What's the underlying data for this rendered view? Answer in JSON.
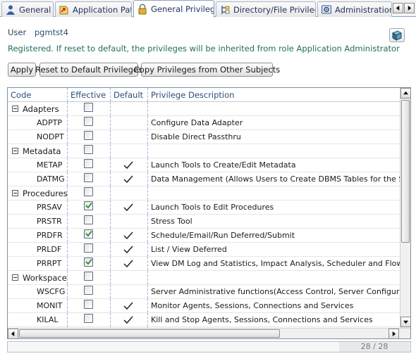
{
  "tabs": [
    {
      "label": "General",
      "icon": "user-icon",
      "active": false
    },
    {
      "label": "Application Path",
      "icon": "app-path-icon",
      "active": false
    },
    {
      "label": "General Privileges",
      "icon": "lock-icon",
      "active": true
    },
    {
      "label": "Directory/File Privileges",
      "icon": "directory-icon",
      "active": false
    },
    {
      "label": "Administration Fi",
      "icon": "admin-icon",
      "active": false
    }
  ],
  "user": {
    "label": "User",
    "value": "pgmtst4"
  },
  "registered_text": "Registered. If reset to default, the privileges will be inherited from role Application Administrator",
  "buttons": {
    "apply": "Apply",
    "reset": "Reset to Default Privileges",
    "copy": "Copy Privileges from Other Subjects"
  },
  "grid": {
    "headers": {
      "code": "Code",
      "effective": "Effective",
      "default": "Default",
      "description": "Privilege Description"
    },
    "rows": [
      {
        "type": "category",
        "label": "Adapters"
      },
      {
        "type": "item",
        "code": "ADPTP",
        "effective": false,
        "default": false,
        "description": "Configure Data Adapter"
      },
      {
        "type": "item",
        "code": "NODPT",
        "effective": false,
        "default": false,
        "description": "Disable Direct Passthru"
      },
      {
        "type": "category",
        "label": "Metadata"
      },
      {
        "type": "item",
        "code": "METAP",
        "effective": false,
        "default": true,
        "description": "Launch Tools to Create/Edit Metadata"
      },
      {
        "type": "item",
        "code": "DATMG",
        "effective": false,
        "default": true,
        "description": "Data Management (Allows Users to Create DBMS Tables for the Synonym"
      },
      {
        "type": "category",
        "label": "Procedures"
      },
      {
        "type": "item",
        "code": "PRSAV",
        "effective": true,
        "default": true,
        "description": "Launch Tools to Edit Procedures"
      },
      {
        "type": "item",
        "code": "PRSTR",
        "effective": false,
        "default": false,
        "description": "Stress Tool"
      },
      {
        "type": "item",
        "code": "PRDFR",
        "effective": true,
        "default": true,
        "description": "Schedule/Email/Run Deferred/Submit"
      },
      {
        "type": "item",
        "code": "PRLDF",
        "effective": false,
        "default": true,
        "description": "List / View Deferred"
      },
      {
        "type": "item",
        "code": "PRRPT",
        "effective": true,
        "default": true,
        "description": "View DM Log and Statistics, Impact Analysis, Scheduler and Flow Reports"
      },
      {
        "type": "category",
        "label": "Workspace"
      },
      {
        "type": "item",
        "code": "WSCFG",
        "effective": false,
        "default": false,
        "description": "Server Administrative functions(Access Control, Server Configuration and"
      },
      {
        "type": "item",
        "code": "MONIT",
        "effective": false,
        "default": true,
        "description": "Monitor Agents, Sessions, Connections and Services"
      },
      {
        "type": "item",
        "code": "KILAL",
        "effective": false,
        "default": true,
        "description": "Kill and Stop Agents, Sessions, Connections and Services"
      },
      {
        "type": "item",
        "code": "",
        "effective": false,
        "default": false,
        "description": ""
      }
    ]
  },
  "status": {
    "count": "28 / 28"
  },
  "colors": {
    "accent": "#2a4f7a",
    "registered": "#1f6f5f",
    "check_green": "#2e9a2e"
  }
}
